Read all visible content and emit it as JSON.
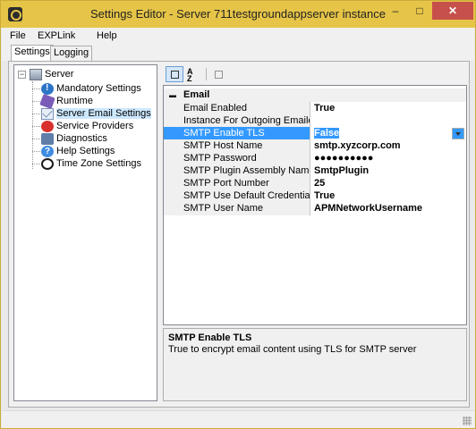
{
  "window": {
    "title": "Settings Editor - Server 711testgroundappserver instance",
    "minimize": "–",
    "maximize": "□",
    "close": "✕"
  },
  "menu": {
    "file": "File",
    "explink": "EXPLink",
    "help": "Help"
  },
  "tabs": {
    "settings": "Settings",
    "logging": "Logging"
  },
  "tree": {
    "root": "Server",
    "items": [
      {
        "label": "Mandatory Settings",
        "icon": "warning-info-icon"
      },
      {
        "label": "Runtime",
        "icon": "runtime-icon"
      },
      {
        "label": "Server Email Settings",
        "icon": "email-icon"
      },
      {
        "label": "Service Providers",
        "icon": "service-providers-icon"
      },
      {
        "label": "Diagnostics",
        "icon": "diagnostics-icon"
      },
      {
        "label": "Help Settings",
        "icon": "help-icon"
      },
      {
        "label": "Time Zone Settings",
        "icon": "clock-icon"
      }
    ],
    "selected": "Server Email Settings"
  },
  "grid": {
    "category": "Email",
    "rows": [
      {
        "name": "Email Enabled",
        "value": "True"
      },
      {
        "name": "Instance For Outgoing Emailed Sh",
        "value": ""
      },
      {
        "name": "SMTP Enable TLS",
        "value": "False"
      },
      {
        "name": "SMTP Host Name",
        "value": "smtp.xyzcorp.com"
      },
      {
        "name": "SMTP Password",
        "value": "●●●●●●●●●●"
      },
      {
        "name": "SMTP Plugin Assembly Name",
        "value": "SmtpPlugin"
      },
      {
        "name": "SMTP Port Number",
        "value": "25"
      },
      {
        "name": "SMTP Use Default Credentials",
        "value": "True"
      },
      {
        "name": "SMTP User Name",
        "value": "APMNetworkUsername"
      }
    ],
    "selected_row": "SMTP Enable TLS"
  },
  "description": {
    "title": "SMTP Enable TLS",
    "text": "True to encrypt email content using TLS for SMTP server"
  },
  "colors": {
    "titlebar": "#e6c447",
    "selection": "#3399ff",
    "close": "#c7504b"
  }
}
